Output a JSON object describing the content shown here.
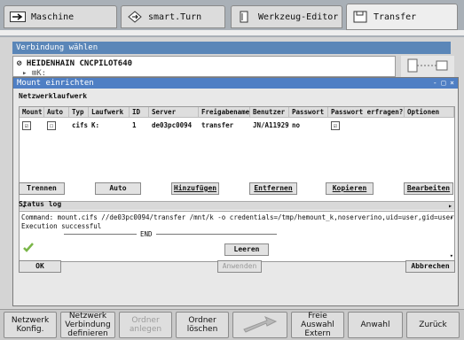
{
  "tabs": [
    {
      "label": "Maschine",
      "icon": "arrow-right-icon"
    },
    {
      "label": "smart.Turn",
      "icon": "diamond-arrow-icon"
    },
    {
      "label": "Werkzeug-Editor",
      "icon": "tool-icon"
    },
    {
      "label": "Transfer",
      "icon": "transfer-icon"
    }
  ],
  "verbindung": {
    "title": "Verbindung wählen",
    "items": [
      "HEIDENHAIN CNCPILOT640",
      "K:"
    ]
  },
  "dialog": {
    "title": "Mount einrichten",
    "title_controls": "- □ ×",
    "section_netz": "Netzwerklaufwerk",
    "columns": [
      "Mount",
      "Auto",
      "Typ",
      "Laufwerk",
      "ID",
      "Server",
      "Freigabename",
      "Benutzer",
      "Passwort",
      "Passwort erfragen?",
      "Optionen"
    ],
    "row": {
      "mount": "☑",
      "auto": "☐",
      "typ": "cifs",
      "laufwerk": "K:",
      "id": "1",
      "server": "de03pc0094",
      "freigabe": "transfer",
      "benutzer": "JN/A11929",
      "passwort": "no",
      "erfragen": "☑",
      "optionen": ""
    },
    "buttons": [
      "Trennen",
      "Auto",
      "Hinzufügen",
      "Entfernen",
      "Kopieren",
      "Bearbeiten"
    ],
    "status_label": "Status log",
    "log_line1": "Command: mount.cifs //de03pc0094/transfer /mnt/k -o credentials=/tmp/hemount_k,noserverino,uid=user,gid=user",
    "log_line2": "Execution successful",
    "log_end": "END",
    "leeren": "Leeren",
    "ok": "OK",
    "anwenden": "Anwenden",
    "abbrechen": "Abbrechen",
    "colors": {
      "title_bg": "#4f7fc4",
      "check": "#7ab648"
    }
  },
  "softkeys": [
    {
      "label": "Netzwerk\nKonfig.",
      "enabled": true
    },
    {
      "label": "Netzwerk\nVerbindung\ndefinieren",
      "enabled": true
    },
    {
      "label": "Ordner\nanlegen",
      "enabled": false
    },
    {
      "label": "Ordner\nlöschen",
      "enabled": true
    },
    {
      "label": "",
      "enabled": false
    },
    {
      "label": "Freie\nAuswahl\nExtern",
      "enabled": true
    },
    {
      "label": "Anwahl",
      "enabled": true
    },
    {
      "label": "Zurück",
      "enabled": true
    }
  ]
}
